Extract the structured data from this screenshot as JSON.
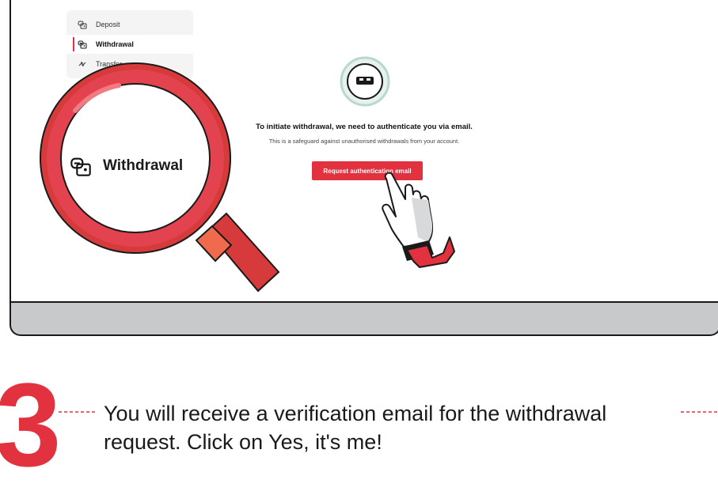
{
  "menu": {
    "items": [
      {
        "label": "Deposit",
        "icon": "wallet-icon"
      },
      {
        "label": "Withdrawal",
        "icon": "wallet-out-icon",
        "active": true
      },
      {
        "label": "Transfer",
        "icon": "transfer-icon"
      }
    ]
  },
  "auth": {
    "icon": "lock-icon",
    "heading": "To initiate withdrawal, we need to authenticate you via email.",
    "subtext": "This is a safeguard against unauthorised withdrawals from your account.",
    "button_label": "Request authentication email"
  },
  "magnifier": {
    "label": "Withdrawal",
    "icon": "wallet-out-icon"
  },
  "step": {
    "number": "3",
    "text": "You will receive a verification email for the withdrawal request. Click on Yes, it's me!"
  },
  "colors": {
    "accent": "#e2323f",
    "lens_ring": "#e2434e",
    "handle": "#d63a3a",
    "bezel": "#c7c9cb",
    "lock_ring": "#b9d9cc"
  }
}
